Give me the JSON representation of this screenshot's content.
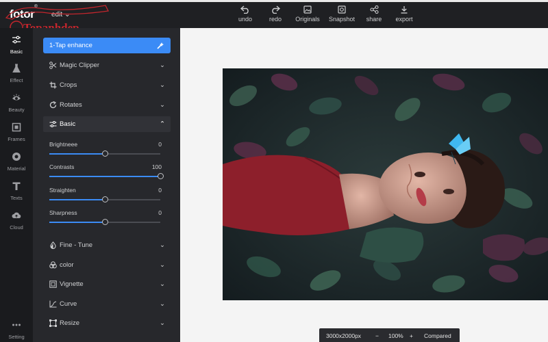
{
  "app": {
    "logo": "fotor",
    "logo_mark": "®",
    "menu_label": "edit",
    "watermark": "Topanhdep"
  },
  "toolbar": [
    {
      "label": "undo",
      "icon": "undo-icon"
    },
    {
      "label": "redo",
      "icon": "redo-icon"
    },
    {
      "label": "Originals",
      "icon": "image-icon"
    },
    {
      "label": "Snapshot",
      "icon": "snapshot-icon"
    },
    {
      "label": "share",
      "icon": "share-icon"
    },
    {
      "label": "export",
      "icon": "download-icon"
    }
  ],
  "rail": [
    {
      "label": "Basic",
      "icon": "sliders-icon",
      "active": true
    },
    {
      "label": "Effect",
      "icon": "flask-icon"
    },
    {
      "label": "Beauty",
      "icon": "eye-icon"
    },
    {
      "label": "Frames",
      "icon": "frame-icon"
    },
    {
      "label": "Material",
      "icon": "material-icon"
    },
    {
      "label": "Texts",
      "icon": "text-icon"
    },
    {
      "label": "Cloud",
      "icon": "cloud-icon"
    },
    {
      "label": "Setting",
      "icon": "more-icon"
    }
  ],
  "panel": {
    "enhance": "1-Tap enhance",
    "rows": [
      {
        "label": "Magic Clipper",
        "icon": "scissors-icon"
      },
      {
        "label": "Crops",
        "icon": "crop-icon"
      },
      {
        "label": "Rotates",
        "icon": "rotate-icon"
      },
      {
        "label": "Basic",
        "icon": "sliders-icon",
        "open": true
      }
    ],
    "sliders": [
      {
        "label": "Brightneee",
        "value": "0",
        "fraction": 0.5
      },
      {
        "label": "Contrasts",
        "value": "100",
        "fraction": 1.0
      },
      {
        "label": "Straighten",
        "value": "0",
        "fraction": 0.5
      },
      {
        "label": "Sharpness",
        "value": "0",
        "fraction": 0.5
      }
    ],
    "more_rows": [
      {
        "label": "Fine - Tune",
        "icon": "droplet-icon"
      },
      {
        "label": "color",
        "icon": "color-icon"
      },
      {
        "label": "Vignette",
        "icon": "vignette-icon"
      },
      {
        "label": "Curve",
        "icon": "curve-icon"
      },
      {
        "label": "Resize",
        "icon": "resize-icon"
      }
    ]
  },
  "status": {
    "dimensions": "3000x2000px",
    "zoom": "100%",
    "minus": "−",
    "plus": "+",
    "compare": "Compared"
  },
  "colors": {
    "accent": "#3b8bf6",
    "panel": "#27282c",
    "rail": "#1a1b1e",
    "topbar": "#1f2023"
  }
}
